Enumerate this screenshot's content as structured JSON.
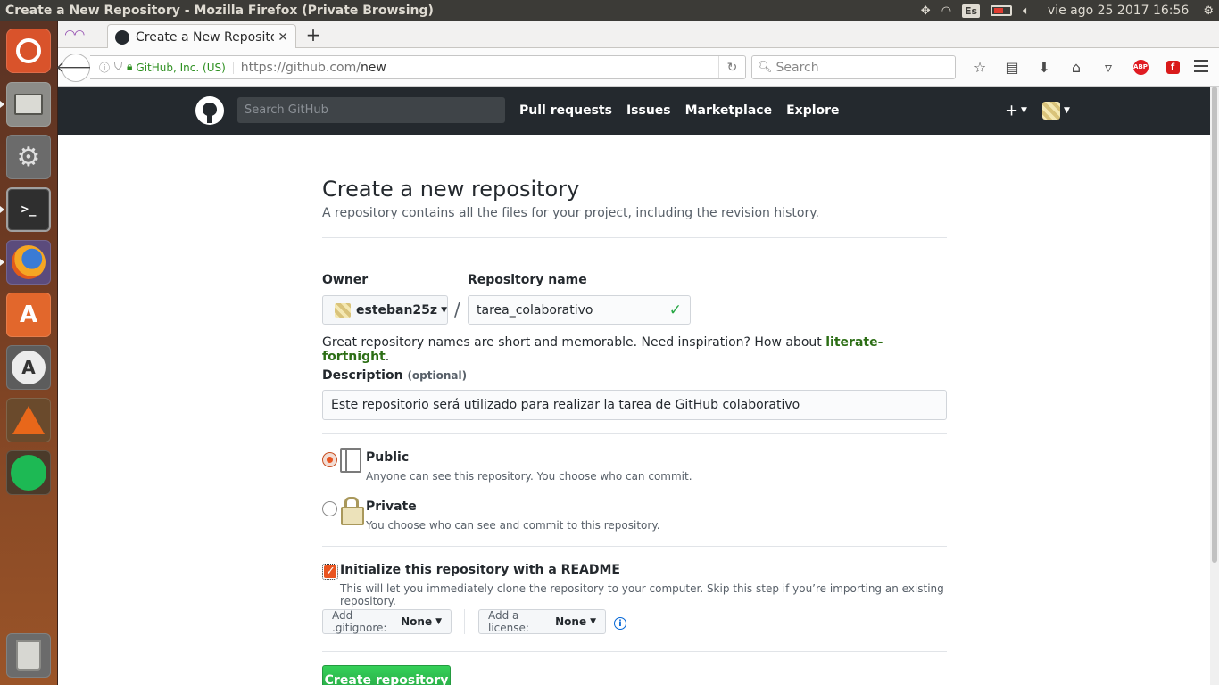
{
  "os_panel": {
    "window_title": "Create a New Repository - Mozilla Firefox (Private Browsing)",
    "keyboard_layout": "Es",
    "clock": "vie ago 25 2017 16:56"
  },
  "launcher": {
    "apps": [
      "ubuntu-dash",
      "files",
      "system-settings",
      "terminal",
      "firefox",
      "software-center",
      "software-updater",
      "matlab",
      "spotify",
      "trash"
    ]
  },
  "browser": {
    "tab_title": "Create a New Reposito",
    "identity_label": "GitHub, Inc. (US)",
    "url_host": "https://github.com/",
    "url_path": "new",
    "search_placeholder": "Search",
    "abp_label": "ABP",
    "flash_label": "f"
  },
  "github_header": {
    "search_placeholder": "Search GitHub",
    "nav": [
      "Pull requests",
      "Issues",
      "Marketplace",
      "Explore"
    ],
    "plus": "+"
  },
  "form": {
    "title": "Create a new repository",
    "subtitle": "A repository contains all the files for your project, including the revision history.",
    "owner_label": "Owner",
    "owner_value": "esteban25z",
    "repo_name_label": "Repository name",
    "separator": "/",
    "repo_name_value": "tarea_colaborativo",
    "hint_text": "Great repository names are short and memorable. Need inspiration? How about ",
    "hint_suggestion": "literate-fortnight",
    "hint_end": ".",
    "description_label": "Description",
    "description_optional": "(optional)",
    "description_value": "Este repositorio será utilizado para realizar la tarea de GitHub colaborativo",
    "visibility": [
      {
        "title": "Public",
        "note": "Anyone can see this repository. You choose who can commit.",
        "selected": true
      },
      {
        "title": "Private",
        "note": "You choose who can see and commit to this repository.",
        "selected": false
      }
    ],
    "readme_checked": true,
    "readme_label": "Initialize this repository with a README",
    "readme_note": "This will let you immediately clone the repository to your computer. Skip this step if you’re importing an existing repository.",
    "gitignore_label": "Add .gitignore:",
    "gitignore_value": "None",
    "license_label": "Add a license:",
    "license_value": "None",
    "submit_label": "Create repository"
  },
  "colors": {
    "github_header_bg": "#24292e",
    "create_button": "#28a745",
    "ubuntu_accent": "#e95420",
    "suggestion_link": "#2c6e15"
  }
}
